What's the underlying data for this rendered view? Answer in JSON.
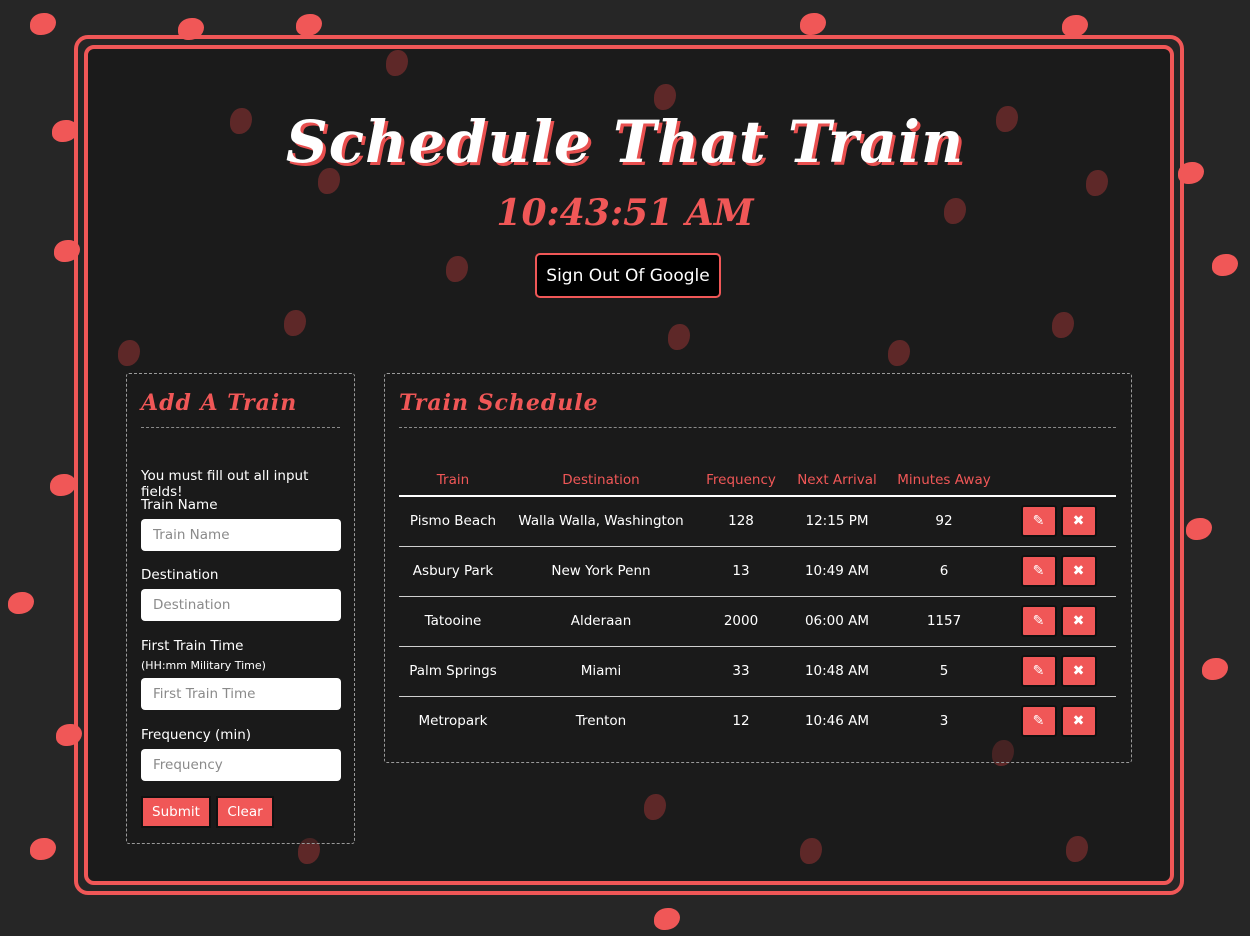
{
  "header": {
    "title": "Schedule That Train",
    "clock": "10:43:51 AM",
    "signout_label": "Sign Out Of Google"
  },
  "add_panel": {
    "heading": "Add A Train",
    "notice": "You must fill out all input fields!",
    "fields": [
      {
        "label": "Train Name",
        "placeholder": "Train Name",
        "value": ""
      },
      {
        "label": "Destination",
        "placeholder": "Destination",
        "value": ""
      },
      {
        "label": "First Train Time",
        "sublabel": "(HH:mm Military Time)",
        "placeholder": "First Train Time",
        "value": ""
      },
      {
        "label": "Frequency (min)",
        "placeholder": "Frequency",
        "value": ""
      }
    ],
    "submit_label": "Submit",
    "clear_label": "Clear"
  },
  "schedule_panel": {
    "heading": "Train Schedule",
    "columns": [
      "Train",
      "Destination",
      "Frequency",
      "Next Arrival",
      "Minutes Away"
    ],
    "rows": [
      {
        "train": "Pismo Beach",
        "destination": "Walla Walla, Washington",
        "frequency": "128",
        "next_arrival": "12:15 PM",
        "minutes_away": "92"
      },
      {
        "train": "Asbury Park",
        "destination": "New York Penn",
        "frequency": "13",
        "next_arrival": "10:49 AM",
        "minutes_away": "6"
      },
      {
        "train": "Tatooine",
        "destination": "Alderaan",
        "frequency": "2000",
        "next_arrival": "06:00 AM",
        "minutes_away": "1157"
      },
      {
        "train": "Palm Springs",
        "destination": "Miami",
        "frequency": "33",
        "next_arrival": "10:48 AM",
        "minutes_away": "5"
      },
      {
        "train": "Metropark",
        "destination": "Trenton",
        "frequency": "12",
        "next_arrival": "10:46 AM",
        "minutes_away": "3"
      }
    ],
    "edit_icon": "pencil-icon",
    "delete_icon": "x-icon"
  },
  "theme": {
    "accent": "#f05757",
    "background": "#262626",
    "panel": "#1b1b1b"
  }
}
